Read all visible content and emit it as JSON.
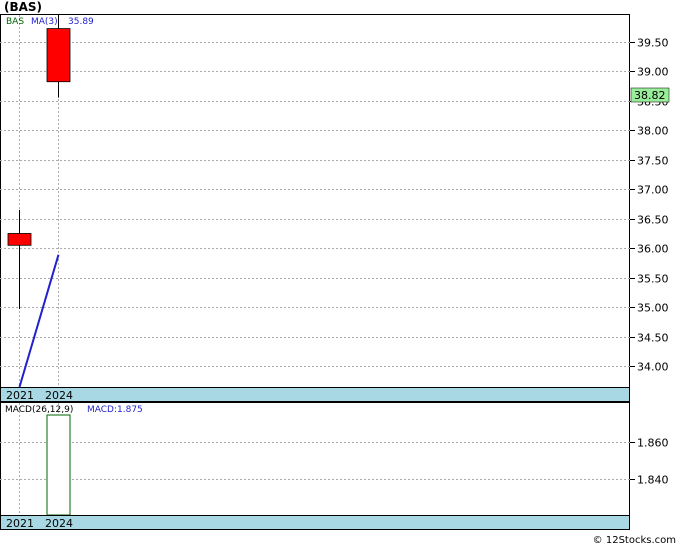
{
  "title": "(BAS)",
  "credit": "© 12Stocks.com",
  "chart_data": [
    {
      "type": "candlestick",
      "legend": {
        "symbol": "BAS",
        "ma_label": "MA(3)",
        "ma_value": "35.89"
      },
      "x_labels": [
        "2021",
        "2024"
      ],
      "candles": [
        {
          "x": "2021",
          "open": 36.25,
          "close": 36.05,
          "high": 36.65,
          "low": 34.97
        },
        {
          "x": "2024",
          "open": 39.72,
          "close": 38.82,
          "high": 39.95,
          "low": 38.55
        }
      ],
      "ma_line": [
        {
          "x": "2021",
          "y": 33.65
        },
        {
          "x": "2024",
          "y": 35.89
        }
      ],
      "y_ticks": [
        "34.00",
        "34.50",
        "35.00",
        "35.50",
        "36.00",
        "36.50",
        "37.00",
        "37.50",
        "38.00",
        "38.50",
        "39.00",
        "39.50"
      ],
      "ylim": [
        33.65,
        39.95
      ],
      "last_price": "38.82",
      "grid": true,
      "colors": {
        "down": "#ff0000",
        "ma": "#2222cc",
        "last_price_bg": "#99ee99",
        "axis_band": "#a8d8e4"
      }
    },
    {
      "type": "bar",
      "label": "MACD(26,12,9)",
      "value_label": "MACD:1.875",
      "x_labels": [
        "2021",
        "2024"
      ],
      "bars": [
        {
          "x": "2024",
          "value": 1.875
        }
      ],
      "y_ticks": [
        "1.840",
        "1.860"
      ],
      "ylim": [
        1.82,
        1.875
      ],
      "grid": true,
      "colors": {
        "bar_outline": "#006600"
      }
    }
  ]
}
